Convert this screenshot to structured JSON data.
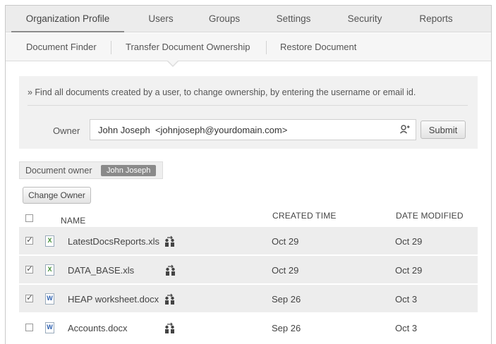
{
  "top_tabs": [
    {
      "label": "Organization Profile",
      "active": true
    },
    {
      "label": "Users"
    },
    {
      "label": "Groups"
    },
    {
      "label": "Settings"
    },
    {
      "label": "Security"
    },
    {
      "label": "Reports"
    }
  ],
  "sub_tabs": [
    {
      "label": "Document Finder"
    },
    {
      "label": "Transfer Document Ownership",
      "active": true
    },
    {
      "label": "Restore Document"
    }
  ],
  "search": {
    "hint": "» Find all documents created by a user, to change ownership, by entering the username or email id.",
    "owner_label": "Owner",
    "owner_value": "John Joseph  <johnjoseph@yourdomain.com>",
    "submit_label": "Submit"
  },
  "doc_owner": {
    "label": "Document owner",
    "name": "John Joseph"
  },
  "change_owner_label": "Change Owner",
  "table": {
    "columns": {
      "name": "NAME",
      "created": "CREATED TIME",
      "modified": "DATE MODIFIED"
    },
    "rows": [
      {
        "name": "LatestDocsReports.xls",
        "type": "xls",
        "created": "Oct 29",
        "modified": "Oct 29",
        "checked": true
      },
      {
        "name": "DATA_BASE.xls",
        "type": "xls",
        "created": "Oct 29",
        "modified": "Oct 29",
        "checked": true
      },
      {
        "name": "HEAP worksheet.docx",
        "type": "doc",
        "created": "Sep 26",
        "modified": "Oct 3",
        "checked": true
      },
      {
        "name": "Accounts.docx",
        "type": "doc",
        "created": "Sep 26",
        "modified": "Oct 3",
        "checked": false
      }
    ]
  },
  "icons": {
    "xls_glyph": "X",
    "doc_glyph": "W",
    "lookup": "user-lookup-icon",
    "share": "shared-users-icon"
  }
}
